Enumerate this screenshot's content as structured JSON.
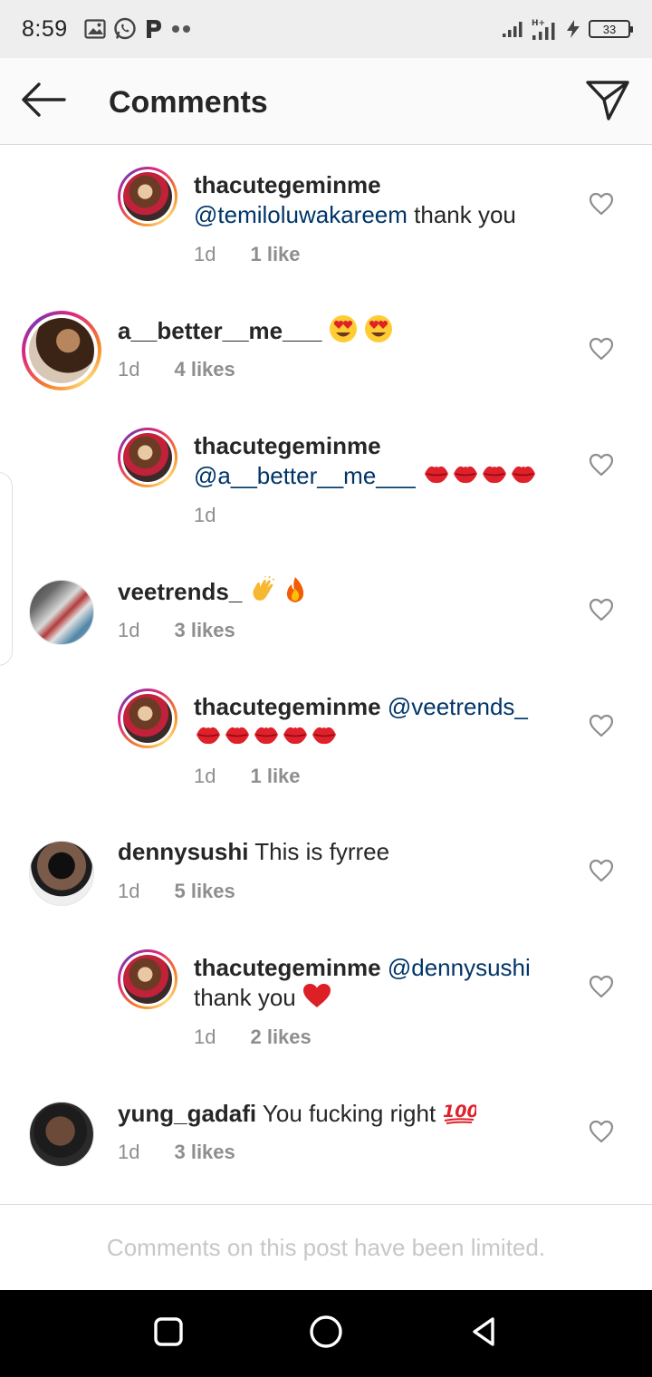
{
  "status_bar": {
    "time": "8:59",
    "left_icons": [
      "gallery-icon",
      "whatsapp-icon",
      "p-icon",
      "more-dots-icon"
    ],
    "right_icons": [
      "signal-icon",
      "signal-4g-icon",
      "charging-icon"
    ],
    "battery": "33"
  },
  "header": {
    "title": "Comments",
    "back_icon": "arrow-left-icon",
    "send_icon": "paper-plane-icon"
  },
  "comments": [
    {
      "username": "thacutegeminme",
      "mention": "@temiloluwakareem",
      "text": " thank you",
      "time": "1d",
      "likes": "1 like",
      "is_reply": true
    },
    {
      "username": "a__better__me___",
      "text": "",
      "emojis": [
        "heart-eyes",
        "heart-eyes"
      ],
      "time": "1d",
      "likes": "4 likes",
      "is_reply": false
    },
    {
      "username": "thacutegeminme",
      "mention": "@a__better__me___",
      "emojis": [
        "kiss-lips",
        "kiss-lips",
        "kiss-lips",
        "kiss-lips"
      ],
      "time": "1d",
      "likes": "",
      "is_reply": true
    },
    {
      "username": "veetrends_",
      "emojis": [
        "clap",
        "fire"
      ],
      "time": "1d",
      "likes": "3 likes",
      "is_reply": false
    },
    {
      "username": "thacutegeminme",
      "mention": "@veetrends_",
      "emojis": [
        "kiss-lips",
        "kiss-lips",
        "kiss-lips",
        "kiss-lips",
        "kiss-lips"
      ],
      "time": "1d",
      "likes": "1 like",
      "is_reply": true
    },
    {
      "username": "dennysushi",
      "text": "This is fyrree",
      "time": "1d",
      "likes": "5 likes",
      "is_reply": false
    },
    {
      "username": "thacutegeminme",
      "mention": "@dennysushi",
      "text": "thank you",
      "emojis": [
        "red-heart"
      ],
      "time": "1d",
      "likes": "2 likes",
      "is_reply": true
    },
    {
      "username": "yung_gadafi",
      "text": "You fucking right",
      "emojis": [
        "hundred"
      ],
      "time": "1d",
      "likes": "3 likes",
      "is_reply": false
    }
  ],
  "footer": {
    "text": "Comments on this post have been limited."
  },
  "navbar": {
    "icons": [
      "recents-icon",
      "home-icon",
      "back-triangle-icon"
    ]
  },
  "colors": {
    "mention": "#003569",
    "meta": "#8e8e8e",
    "footer_text": "#c7c7c7",
    "heart_red": "#ed1c24"
  }
}
